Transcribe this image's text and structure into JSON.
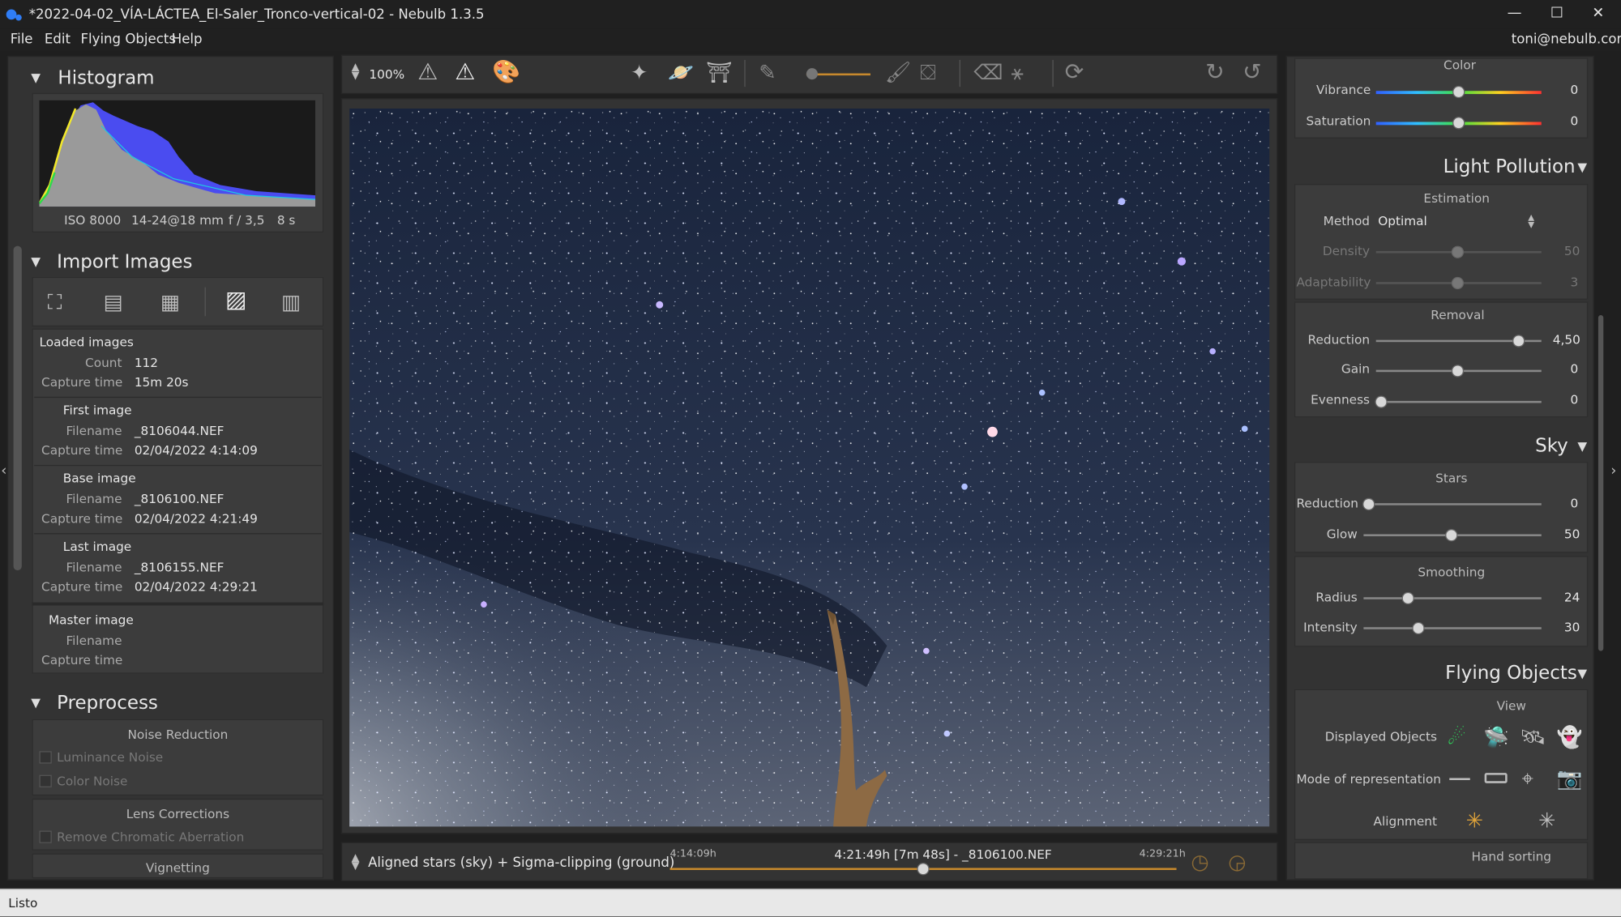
{
  "window": {
    "title": "*2022-04-02_VÍA-LÁCTEA_El-Saler_Tronco-vertical-02 - Nebulb 1.3.5",
    "minimize": "—",
    "maximize": "☐",
    "close": "✕"
  },
  "menu": {
    "items": [
      "File",
      "Edit",
      "Flying Objects",
      "Help"
    ],
    "user": "toni@nebulb.com"
  },
  "histogram": {
    "title": "Histogram",
    "iso": "ISO 8000",
    "lens": "14-24@18 mm",
    "aperture": "f / 3,5",
    "exposure": "8 s"
  },
  "import": {
    "title": "Import Images",
    "loaded": {
      "heading": "Loaded images",
      "count_label": "Count",
      "count": "112",
      "capture_label": "Capture time",
      "capture": "15m 20s"
    },
    "first": {
      "heading": "First image",
      "filename_label": "Filename",
      "filename": "_8106044.NEF",
      "capture_label": "Capture time",
      "capture": "02/04/2022 4:14:09"
    },
    "base": {
      "heading": "Base image",
      "filename_label": "Filename",
      "filename": "_8106100.NEF",
      "capture_label": "Capture time",
      "capture": "02/04/2022 4:21:49"
    },
    "last": {
      "heading": "Last image",
      "filename_label": "Filename",
      "filename": "_8106155.NEF",
      "capture_label": "Capture time",
      "capture": "02/04/2022 4:29:21"
    },
    "master": {
      "heading": "Master image",
      "filename_label": "Filename",
      "capture_label": "Capture time"
    }
  },
  "preprocess": {
    "title": "Preprocess",
    "noise_heading": "Noise Reduction",
    "luminance": "Luminance Noise",
    "color": "Color Noise",
    "lens_heading": "Lens Corrections",
    "chromatic": "Remove Chromatic Aberration",
    "vignetting": "Vignetting"
  },
  "toolbar": {
    "zoom": "100%"
  },
  "bottom": {
    "mode": "Aligned stars (sky) + Sigma-clipping (ground)",
    "start": "4:14:09h",
    "current": "4:21:49h [7m 48s] - _8106100.NEF",
    "end": "4:29:21h",
    "position": 0.5
  },
  "color": {
    "title": "Color",
    "vibrance_label": "Vibrance",
    "vibrance": "0",
    "saturation_label": "Saturation",
    "saturation": "0"
  },
  "light_pollution": {
    "title": "Light Pollution",
    "estimation": "Estimation",
    "method_label": "Method",
    "method": "Optimal",
    "density_label": "Density",
    "density": "50",
    "adaptability_label": "Adaptability",
    "adaptability": "3",
    "removal": "Removal",
    "reduction_label": "Reduction",
    "reduction": "4,50",
    "gain_label": "Gain",
    "gain": "0",
    "evenness_label": "Evenness",
    "evenness": "0"
  },
  "sky": {
    "title": "Sky",
    "stars": "Stars",
    "reduction_label": "Reduction",
    "reduction": "0",
    "glow_label": "Glow",
    "glow": "50",
    "smoothing": "Smoothing",
    "radius_label": "Radius",
    "radius": "24",
    "intensity_label": "Intensity",
    "intensity": "30"
  },
  "flying": {
    "title": "Flying Objects",
    "view": "View",
    "displayed_label": "Displayed Objects",
    "mode_label": "Mode of representation",
    "alignment_label": "Alignment",
    "hand_sorting": "Hand sorting"
  },
  "status": {
    "text": "Listo"
  }
}
